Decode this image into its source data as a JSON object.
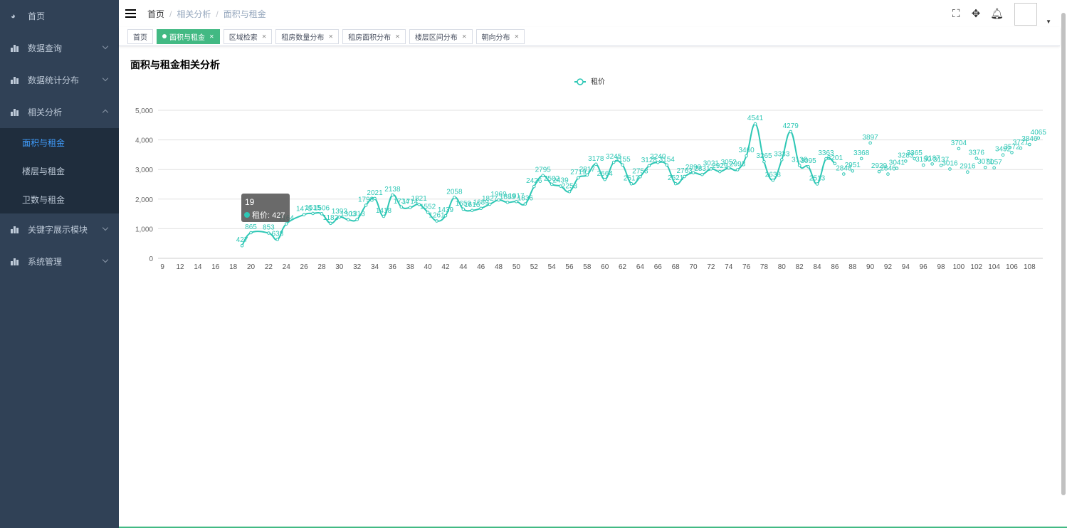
{
  "sidebar": {
    "items": [
      {
        "label": "首页",
        "icon": "dashboard-icon"
      },
      {
        "label": "数据查询",
        "icon": "bar-chart-icon"
      },
      {
        "label": "数据统计分布",
        "icon": "bar-chart-icon"
      },
      {
        "label": "相关分析",
        "icon": "bar-chart-icon",
        "expanded": true,
        "children": [
          {
            "label": "面积与租金",
            "active": true
          },
          {
            "label": "楼层与租金"
          },
          {
            "label": "卫数与租金"
          }
        ]
      },
      {
        "label": "关键字展示模块",
        "icon": "bar-chart-icon"
      },
      {
        "label": "系统管理",
        "icon": "bar-chart-icon"
      }
    ]
  },
  "breadcrumb": [
    "首页",
    "相关分析",
    "面积与租金"
  ],
  "tags": [
    {
      "label": "首页"
    },
    {
      "label": "面积与租金",
      "active": true
    },
    {
      "label": "区域检索"
    },
    {
      "label": "租房数量分布"
    },
    {
      "label": "租房面积分布"
    },
    {
      "label": "楼层区间分布"
    },
    {
      "label": "朝向分布"
    }
  ],
  "page_title": "面积与租金相关分析",
  "tooltip": {
    "title": "19",
    "series": "租价",
    "value": "427"
  },
  "colors": {
    "series": "#2ec7b5",
    "sidebar": "#304156",
    "active_tag": "#42b983",
    "active_menu": "#409eff"
  },
  "chart_data": {
    "type": "line",
    "legend": [
      "租价"
    ],
    "legend_position": "top-center",
    "yticks": [
      "0",
      "1,000",
      "2,000",
      "3,000",
      "4,000",
      "5,000"
    ],
    "ylim": [
      0,
      5000
    ],
    "categories": [
      9,
      11,
      12,
      13,
      14,
      15,
      16,
      17,
      18,
      19,
      20,
      21,
      22,
      23,
      24,
      25,
      26,
      27,
      28,
      29,
      30,
      31,
      32,
      33,
      34,
      35,
      36,
      37,
      38,
      39,
      40,
      41,
      42,
      43,
      44,
      45,
      46,
      47,
      48,
      49,
      50,
      51,
      52,
      53,
      54,
      55,
      56,
      57,
      58,
      59,
      60,
      61,
      62,
      63,
      64,
      65,
      66,
      67,
      68,
      69,
      70,
      71,
      72,
      73,
      74,
      75,
      76,
      77,
      78,
      79,
      80,
      81,
      82,
      83,
      84,
      85,
      86,
      87,
      88,
      89,
      90,
      91,
      92,
      93,
      94,
      95,
      96,
      97,
      98,
      99,
      100,
      101,
      102,
      103,
      104,
      105,
      106,
      107,
      108,
      109
    ],
    "x": [
      19,
      20,
      22,
      23,
      24,
      26,
      27,
      28,
      29,
      30,
      31,
      32,
      33,
      34,
      35,
      36,
      37,
      38,
      39,
      40,
      41,
      42,
      43,
      44,
      45,
      46,
      47,
      48,
      49,
      50,
      51,
      52,
      53,
      54,
      55,
      56,
      57,
      58,
      59,
      60,
      61,
      62,
      63,
      64,
      65,
      66,
      67,
      68,
      69,
      70,
      71,
      72,
      73,
      74,
      75,
      76,
      77,
      78,
      79,
      80,
      81,
      82,
      83,
      84,
      85,
      86,
      87,
      88,
      89,
      90,
      91,
      92,
      93,
      94,
      95,
      96,
      97,
      98,
      99,
      100,
      101,
      102,
      103,
      104,
      105,
      106,
      107,
      108,
      109
    ],
    "values": [
      427,
      865,
      853,
      638,
      1164,
      1475,
      1515,
      1506,
      1182,
      1393,
      1303,
      1313,
      1793,
      2021,
      1418,
      2138,
      1734,
      1714,
      1821,
      1552,
      1261,
      1439,
      2058,
      1659,
      1616,
      1689,
      1827,
      1969,
      1889,
      1917,
      1836,
      2426,
      2795,
      2502,
      2439,
      2253,
      2719,
      2817,
      3178,
      2664,
      3245,
      3155,
      2517,
      2758,
      3128,
      3240,
      3154,
      2521,
      2763,
      2890,
      2831,
      3021,
      2929,
      3052,
      2993,
      3460,
      4541,
      3265,
      2638,
      3333,
      4279,
      3138,
      3095,
      2513,
      3363,
      3201,
      2848,
      2951,
      3368,
      3897,
      2929,
      2846,
      3041,
      3283,
      3365,
      3150,
      3187,
      3137,
      3016,
      3704,
      2916,
      3376,
      3071,
      3057,
      3492,
      3572,
      3721,
      3846,
      4065
    ],
    "line_until_x": 86
  }
}
